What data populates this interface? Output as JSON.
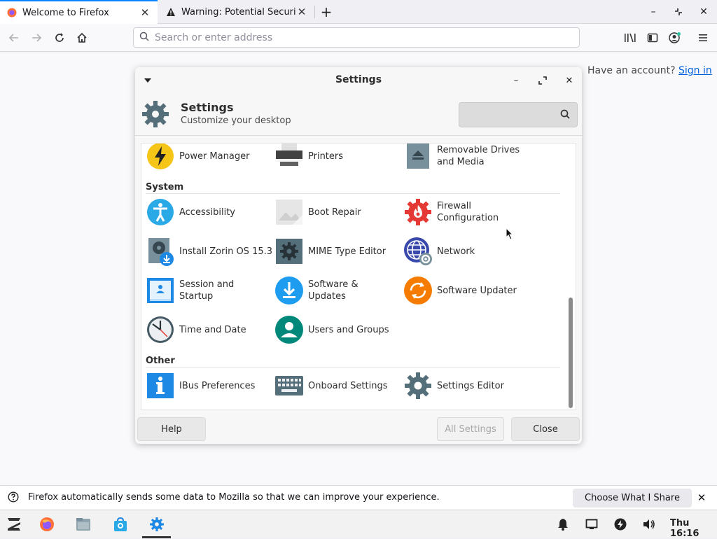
{
  "browser": {
    "tabs": [
      {
        "label": "Welcome to Firefox",
        "active": true
      },
      {
        "label": "Warning: Potential Securit",
        "active": false
      }
    ],
    "url_placeholder": "Search or enter address",
    "account_prompt": "Have an account?",
    "sign_in": "Sign in"
  },
  "dialog": {
    "window_title": "Settings",
    "header_title": "Settings",
    "header_subtitle": "Customize your desktop",
    "search_placeholder": "",
    "sections": [
      {
        "label": "",
        "items": [
          {
            "label_lines": [
              "Power Manager"
            ],
            "icon": "power-manager-icon"
          },
          {
            "label_lines": [
              "Printers"
            ],
            "icon": "printer-icon"
          },
          {
            "label_lines": [
              "Removable Drives",
              "and Media"
            ],
            "icon": "removable-drive-icon"
          }
        ]
      },
      {
        "label": "System",
        "items": [
          {
            "label_lines": [
              "Accessibility"
            ],
            "icon": "accessibility-icon"
          },
          {
            "label_lines": [
              "Boot Repair"
            ],
            "icon": "boot-repair-icon"
          },
          {
            "label_lines": [
              "Firewall",
              "Configuration"
            ],
            "icon": "firewall-icon"
          },
          {
            "label_lines": [
              "Install Zorin OS 15.3"
            ],
            "icon": "install-disk-icon"
          },
          {
            "label_lines": [
              "MIME Type Editor"
            ],
            "icon": "mime-editor-icon"
          },
          {
            "label_lines": [
              "Network"
            ],
            "icon": "network-icon"
          },
          {
            "label_lines": [
              "Session and",
              "Startup"
            ],
            "icon": "session-startup-icon"
          },
          {
            "label_lines": [
              "Software &",
              "Updates"
            ],
            "icon": "software-updates-icon"
          },
          {
            "label_lines": [
              "Software Updater"
            ],
            "icon": "software-updater-icon"
          },
          {
            "label_lines": [
              "Time and Date"
            ],
            "icon": "clock-icon"
          },
          {
            "label_lines": [
              "Users and Groups"
            ],
            "icon": "users-icon"
          }
        ]
      },
      {
        "label": "Other",
        "items": [
          {
            "label_lines": [
              "IBus Preferences"
            ],
            "icon": "info-icon"
          },
          {
            "label_lines": [
              "Onboard Settings"
            ],
            "icon": "keyboard-icon"
          },
          {
            "label_lines": [
              "Settings Editor"
            ],
            "icon": "gear-icon"
          }
        ]
      }
    ],
    "footer": {
      "help": "Help",
      "all_settings": "All Settings",
      "close": "Close"
    }
  },
  "notification": {
    "text": "Firefox automatically sends some data to Mozilla so that we can improve your experience.",
    "button": "Choose What I Share"
  },
  "taskbar": {
    "clock": "Thu 16:16"
  },
  "colors": {
    "accent": "#0a84ff",
    "link": "#0060df",
    "firewall_red": "#e53935",
    "power_yellow": "#f5c518",
    "updater_orange": "#f57c00",
    "blue_icon": "#1e88e5",
    "teal_icon": "#00897b"
  }
}
